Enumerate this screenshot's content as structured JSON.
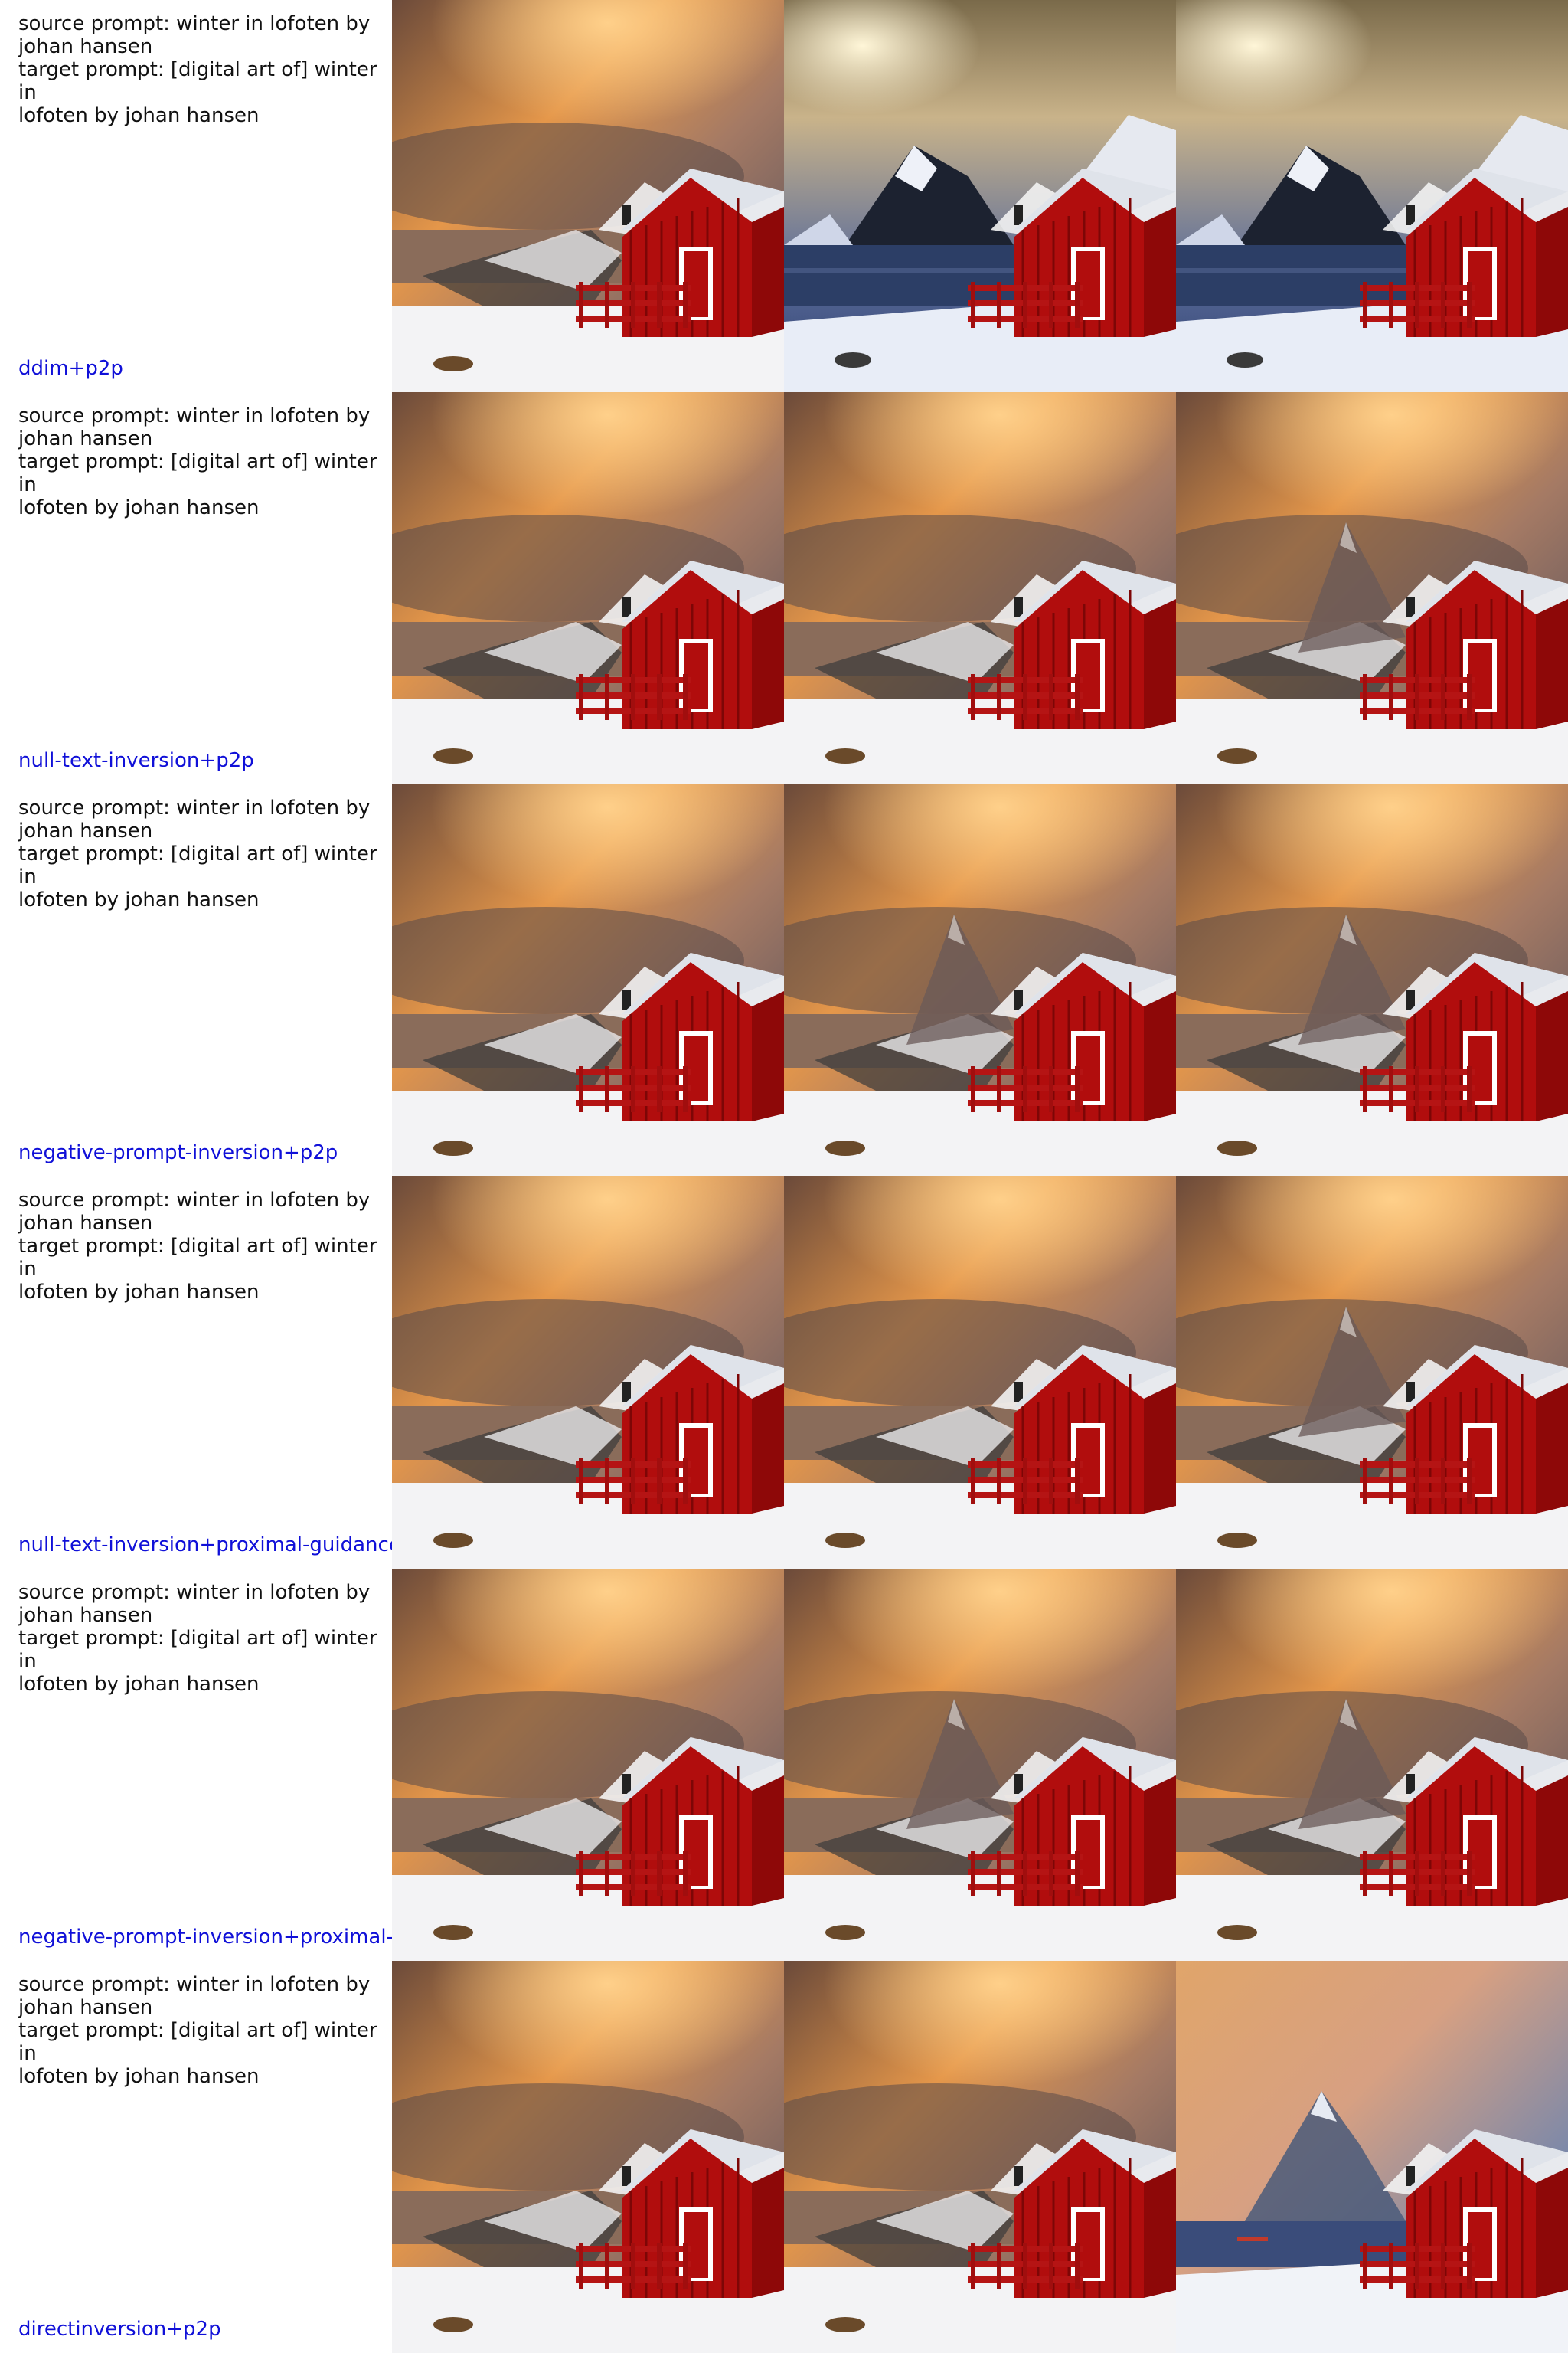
{
  "rows": [
    {
      "prompt": "source prompt: winter in lofoten by\njohan hansen\ntarget prompt: [digital art of] winter in\nlofoten by johan hansen",
      "method": "ddim+p2p"
    },
    {
      "prompt": "source prompt: winter in lofoten by\njohan hansen\ntarget prompt: [digital art of] winter in\nlofoten by johan hansen",
      "method": "null-text-inversion+p2p"
    },
    {
      "prompt": "source prompt: winter in lofoten by\njohan hansen\ntarget prompt: [digital art of] winter in\nlofoten by johan hansen",
      "method": "negative-prompt-inversion+p2p"
    },
    {
      "prompt": "source prompt: winter in lofoten by\njohan hansen\ntarget prompt: [digital art of] winter in\nlofoten by johan hansen",
      "method": "null-text-inversion+proximal-guidance"
    },
    {
      "prompt": "source prompt: winter in lofoten by\njohan hansen\ntarget prompt: [digital art of] winter in\nlofoten by johan hansen",
      "method": "negative-prompt-inversion+proximal-guidance"
    },
    {
      "prompt": "source prompt: winter in lofoten by\njohan hansen\ntarget prompt: [digital art of] winter in\nlofoten by johan hansen",
      "method": "directinversion+p2p"
    }
  ],
  "image_variants": [
    [
      "storm",
      "clear",
      "clear"
    ],
    [
      "storm",
      "storm",
      "peak"
    ],
    [
      "storm",
      "peak",
      "peak"
    ],
    [
      "storm",
      "storm",
      "peak"
    ],
    [
      "storm",
      "peak",
      "peak"
    ],
    [
      "storm",
      "storm",
      "bluepeak"
    ]
  ]
}
